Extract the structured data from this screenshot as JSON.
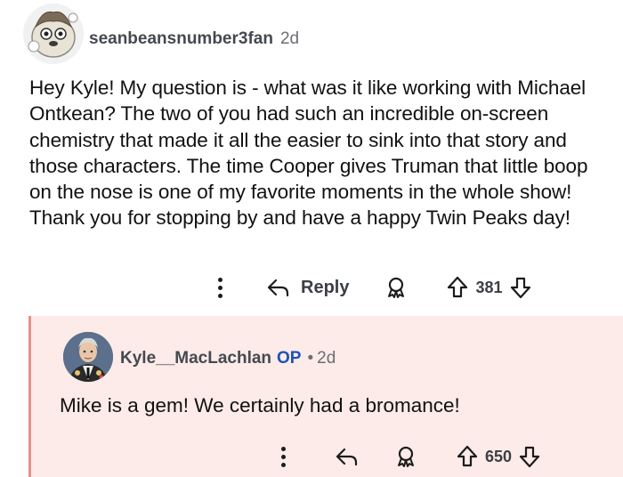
{
  "comment": {
    "username": "seanbeansnumber3fan",
    "age": "2d",
    "body": "Hey Kyle! My question is - what was it like working with Michael Ontkean? The two of you had such an incredible on-screen chemistry that made it all the easier to sink into that story and those characters. The time Cooper gives Truman that little boop on the nose is one of my favorite moments in the whole show! Thank you for stopping by and have a happy Twin Peaks day!",
    "reply_label": "Reply",
    "votes": "381"
  },
  "reply": {
    "username": "Kyle__MacLachlan",
    "op_badge": "OP",
    "separator": "•",
    "age": "2d",
    "body": "Mike is a gem! We certainly had a bromance!",
    "votes": "650"
  },
  "icons": [
    "more-icon",
    "reply-arrow-icon",
    "award-icon",
    "upvote-icon",
    "downvote-icon"
  ]
}
